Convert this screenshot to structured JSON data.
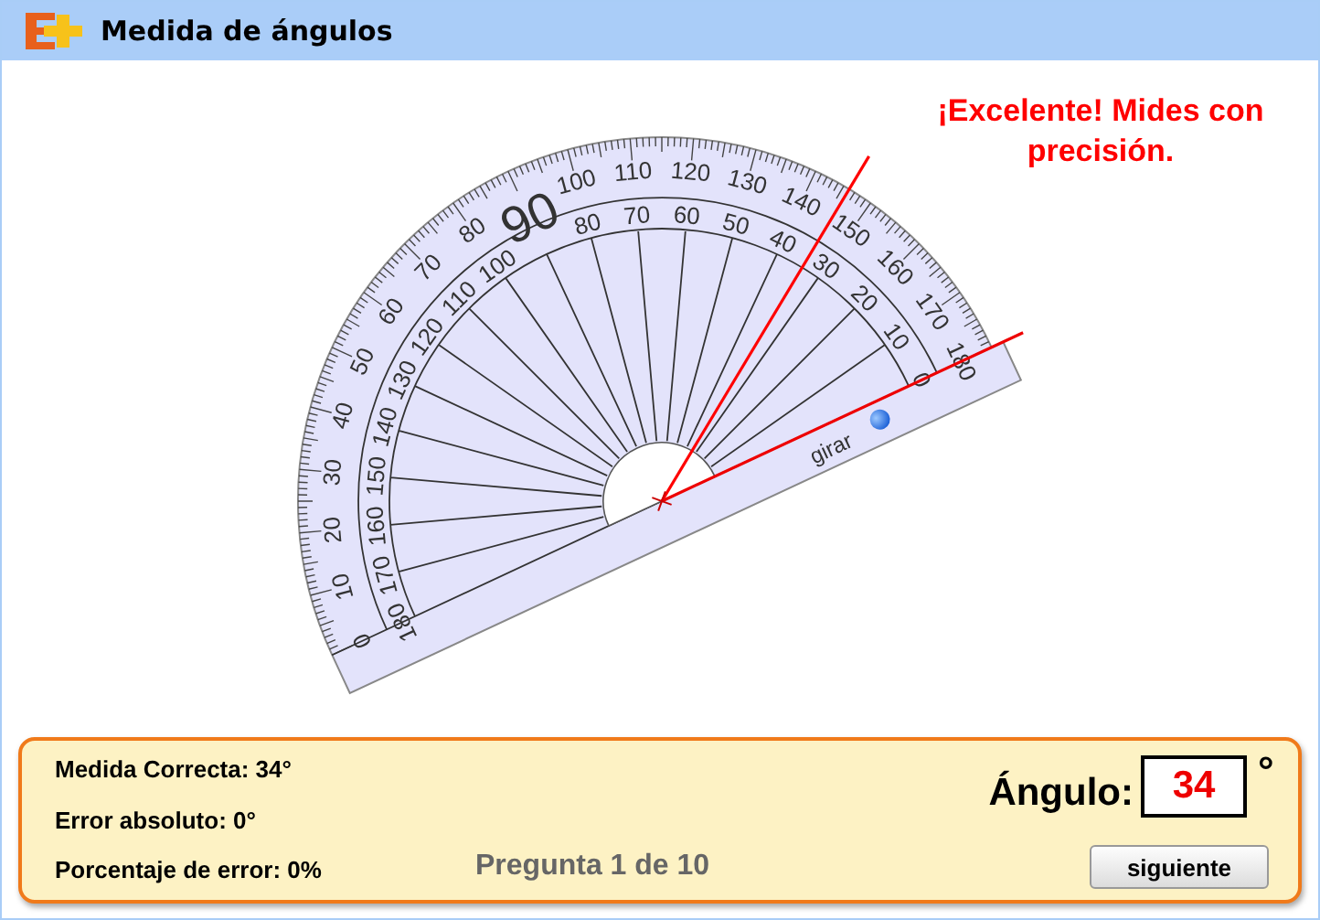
{
  "window": {
    "title": "Medida de ángulos"
  },
  "feedback": "¡Excelente! Mides con precisión.",
  "protractor": {
    "handle_label": "girar",
    "scale": [
      {
        "outer": "0",
        "inner": "180"
      },
      {
        "outer": "10",
        "inner": "170"
      },
      {
        "outer": "20",
        "inner": "160"
      },
      {
        "outer": "30",
        "inner": "150"
      },
      {
        "outer": "40",
        "inner": "140"
      },
      {
        "outer": "50",
        "inner": "130"
      },
      {
        "outer": "60",
        "inner": "120"
      },
      {
        "outer": "70",
        "inner": "110"
      },
      {
        "outer": "80",
        "inner": "100"
      },
      {
        "center": "90"
      },
      {
        "outer": "100",
        "inner": "80"
      },
      {
        "outer": "110",
        "inner": "70"
      },
      {
        "outer": "120",
        "inner": "60"
      },
      {
        "outer": "130",
        "inner": "50"
      },
      {
        "outer": "140",
        "inner": "40"
      },
      {
        "outer": "150",
        "inner": "30"
      },
      {
        "outer": "160",
        "inner": "20"
      },
      {
        "outer": "170",
        "inner": "10"
      },
      {
        "outer": "180",
        "inner": "0"
      }
    ]
  },
  "results": [
    "Medida Correcta: 34°",
    "Error absoluto: 0°",
    "Porcentaje de error: 0%"
  ],
  "question": "Pregunta 1 de 10",
  "answer": {
    "label": "Ángulo:",
    "value": "34",
    "unit": "°"
  },
  "buttons": [
    "siguiente"
  ]
}
